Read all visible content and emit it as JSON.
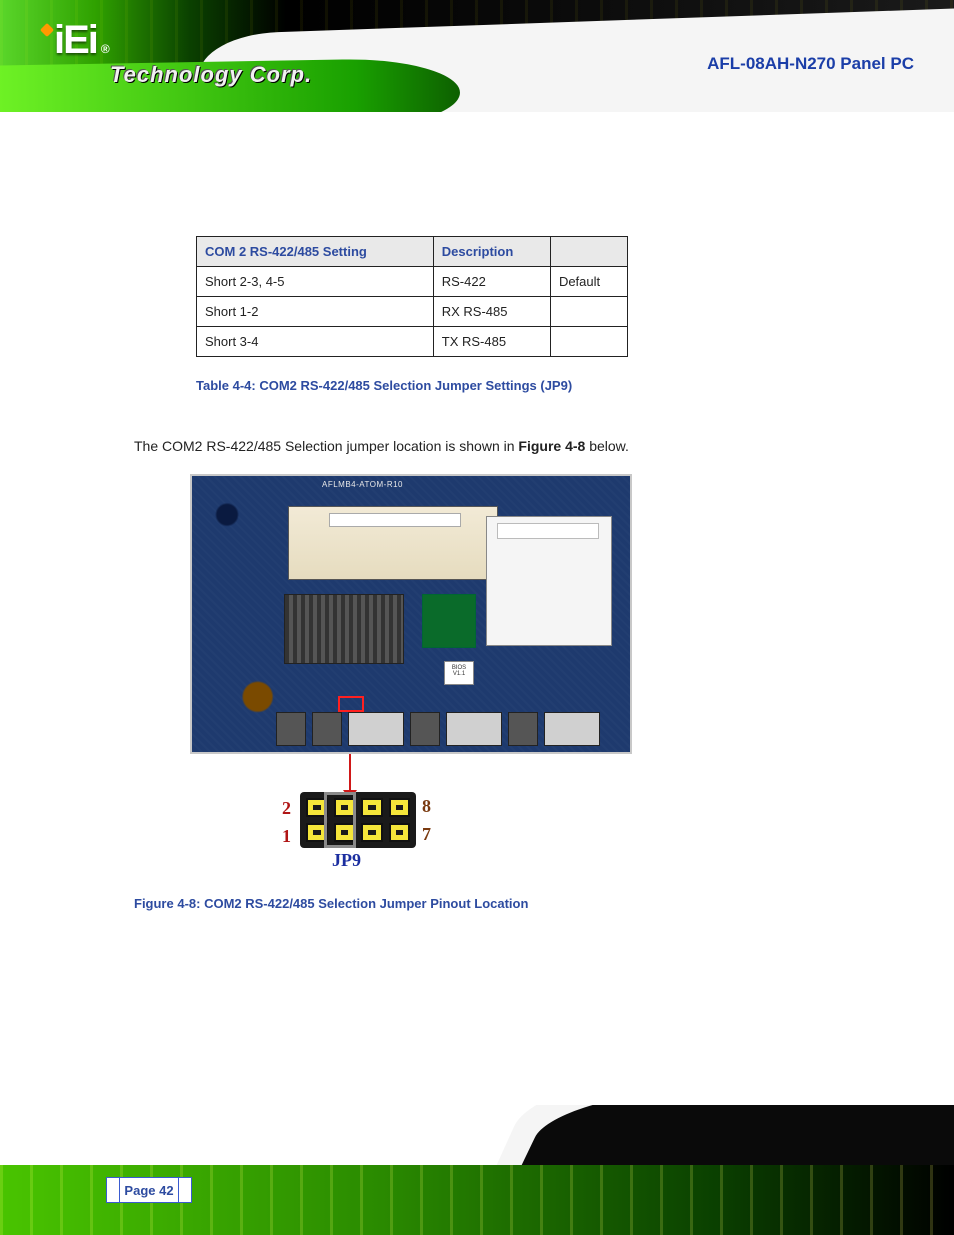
{
  "brand": {
    "logo_text": "iEi",
    "registered": "®",
    "tagline": "Technology Corp."
  },
  "product_title": "AFL-08AH-N270 Panel PC",
  "table": {
    "headers": [
      "COM 2 RS-422/485 Setting",
      "Description",
      ""
    ],
    "rows": [
      [
        "Short 2-3, 4-5",
        "RS-422",
        "Default"
      ],
      [
        "Short 1-2",
        "RX RS-485",
        ""
      ],
      [
        "Short 3-4",
        "TX RS-485",
        ""
      ]
    ]
  },
  "table_caption": "Table 4-4: COM2 RS-422/485 Selection Jumper Settings (JP9)",
  "location_sentence_prefix": "The COM2 RS-422/485 Selection jumper location is shown in ",
  "location_sentence_figref": "Figure 4-8",
  "location_sentence_suffix": " below.",
  "board": {
    "silk_label": "AFLMB4-ATOM-R10",
    "bios_label": "BIOS V1.1"
  },
  "jp9": {
    "label": "JP9",
    "pins": {
      "tl": "2",
      "tr": "8",
      "bl": "1",
      "br": "7"
    }
  },
  "figure_caption": "Figure 4-8: COM2 RS-422/485 Selection Jumper Pinout Location",
  "page_number": "Page 42"
}
